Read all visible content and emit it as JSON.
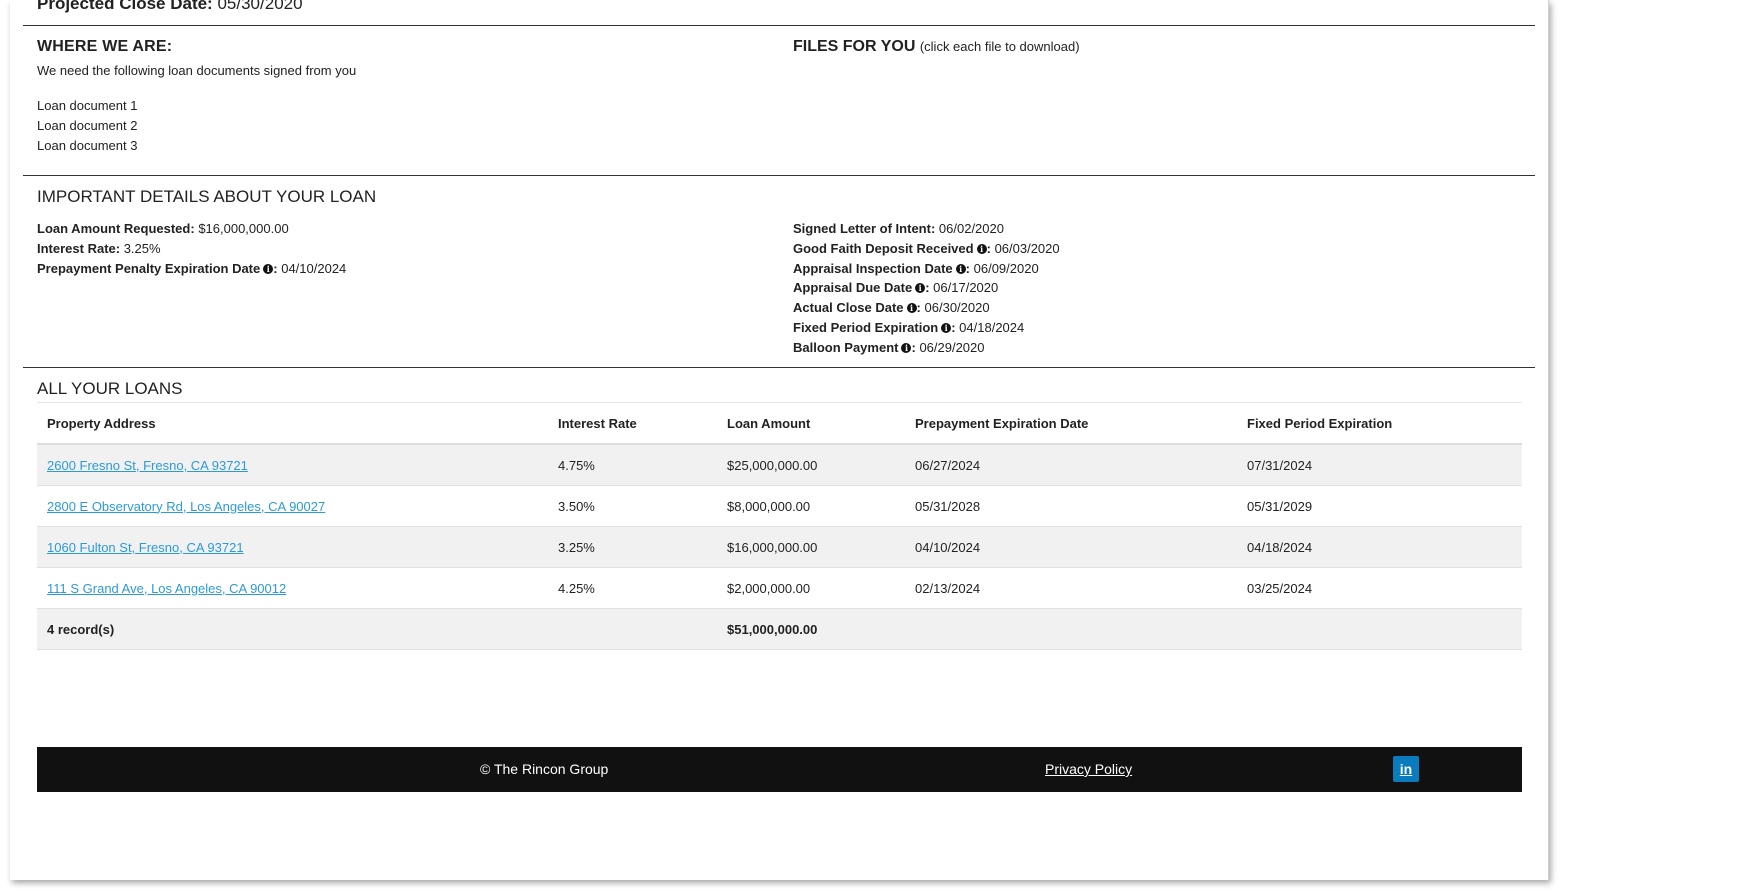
{
  "header": {
    "projected_label": "Projected Close Date:",
    "projected_value": "05/30/2020"
  },
  "where": {
    "title": "WHERE WE ARE:",
    "subtitle": "We need the following loan documents signed from you",
    "documents": [
      "Loan document 1",
      "Loan document 2",
      "Loan document 3"
    ]
  },
  "files": {
    "title": "FILES FOR YOU",
    "note": "(click each file to download)"
  },
  "details": {
    "title": "IMPORTANT DETAILS ABOUT YOUR LOAN",
    "left": [
      {
        "label": "Loan Amount Requested:",
        "value": "$16,000,000.00"
      },
      {
        "label": "Interest Rate:",
        "value": "3.25%"
      },
      {
        "label": "Prepayment Penalty Expiration Date",
        "value": "04/10/2024"
      }
    ],
    "right": [
      {
        "label": "Signed Letter of Intent:",
        "value": "06/02/2020"
      },
      {
        "label": "Good Faith Deposit Received",
        "value": "06/03/2020"
      },
      {
        "label": "Appraisal Inspection Date",
        "value": "06/09/2020"
      },
      {
        "label": "Appraisal Due Date",
        "value": "06/17/2020"
      },
      {
        "label": "Actual Close Date",
        "value": "06/30/2020"
      },
      {
        "label": "Fixed Period Expiration",
        "value": "04/18/2024"
      },
      {
        "label": "Balloon Payment",
        "value": "06/29/2020"
      }
    ]
  },
  "loans": {
    "title": "ALL YOUR LOANS",
    "columns": [
      "Property Address",
      "Interest Rate",
      "Loan Amount",
      "Prepayment Expiration Date",
      "Fixed Period Expiration"
    ],
    "rows": [
      {
        "address": "2600 Fresno St, Fresno, CA 93721",
        "rate": "4.75%",
        "amount": "$25,000,000.00",
        "prepay": "06/27/2024",
        "fixed": "07/31/2024"
      },
      {
        "address": "2800 E Observatory Rd, Los Angeles, CA 90027",
        "rate": "3.50%",
        "amount": "$8,000,000.00",
        "prepay": "05/31/2028",
        "fixed": "05/31/2029"
      },
      {
        "address": "1060 Fulton St, Fresno, CA 93721",
        "rate": "3.25%",
        "amount": "$16,000,000.00",
        "prepay": "04/10/2024",
        "fixed": "04/18/2024"
      },
      {
        "address": "111 S Grand Ave, Los Angeles, CA 90012",
        "rate": "4.25%",
        "amount": "$2,000,000.00",
        "prepay": "02/13/2024",
        "fixed": "03/25/2024"
      }
    ],
    "footer": {
      "records": "4 record(s)",
      "total": "$51,000,000.00"
    }
  },
  "footer": {
    "copyright": "© The Rincon Group",
    "privacy": "Privacy Policy",
    "linkedin_glyph": "in"
  },
  "colors": {
    "link": "#2b9bd8",
    "footer_bg": "#111111",
    "linkedin": "#0a7bbd",
    "row_alt": "#f1f1f1"
  }
}
